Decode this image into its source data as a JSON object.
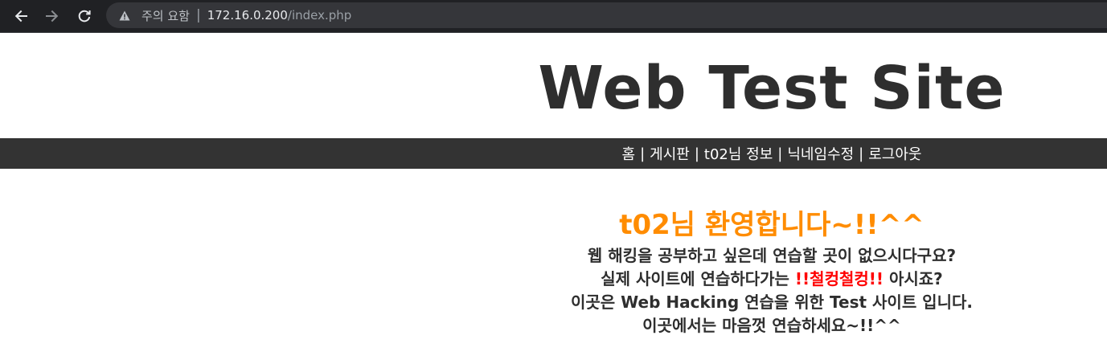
{
  "browser": {
    "security_label": "주의 요함",
    "separator": "|",
    "url_host": "172.16.0.200",
    "url_path": "/index.php"
  },
  "site": {
    "title": "Web Test Site"
  },
  "nav": {
    "items": [
      {
        "label": "홈"
      },
      {
        "label": "게시판"
      },
      {
        "label": "t02님 정보"
      },
      {
        "label": "닉네임수정"
      },
      {
        "label": "로그아웃"
      }
    ],
    "separator": "|"
  },
  "content": {
    "welcome": "t02님 환영합니다~!!^^",
    "line1": "웹 해킹을 공부하고 싶은데 연습할 곳이 없으시다구요?",
    "line2_before": "실제 사이트에 연습하다가는 ",
    "line2_highlight": "!!철컹철컹!!",
    "line2_after": " 아시죠?",
    "line3": "이곳은 Web Hacking 연습을 위한 Test 사이트 입니다.",
    "line4": "이곳에서는 마음껏 연습하세요~!!^^"
  },
  "colors": {
    "welcome": "#ff8c00",
    "highlight": "#ff0000",
    "nav_bg": "#333333",
    "browser_bg": "#202124"
  },
  "icons": {
    "back": "arrow-left-icon",
    "forward": "arrow-right-icon",
    "reload": "reload-icon",
    "security": "warning-icon"
  }
}
